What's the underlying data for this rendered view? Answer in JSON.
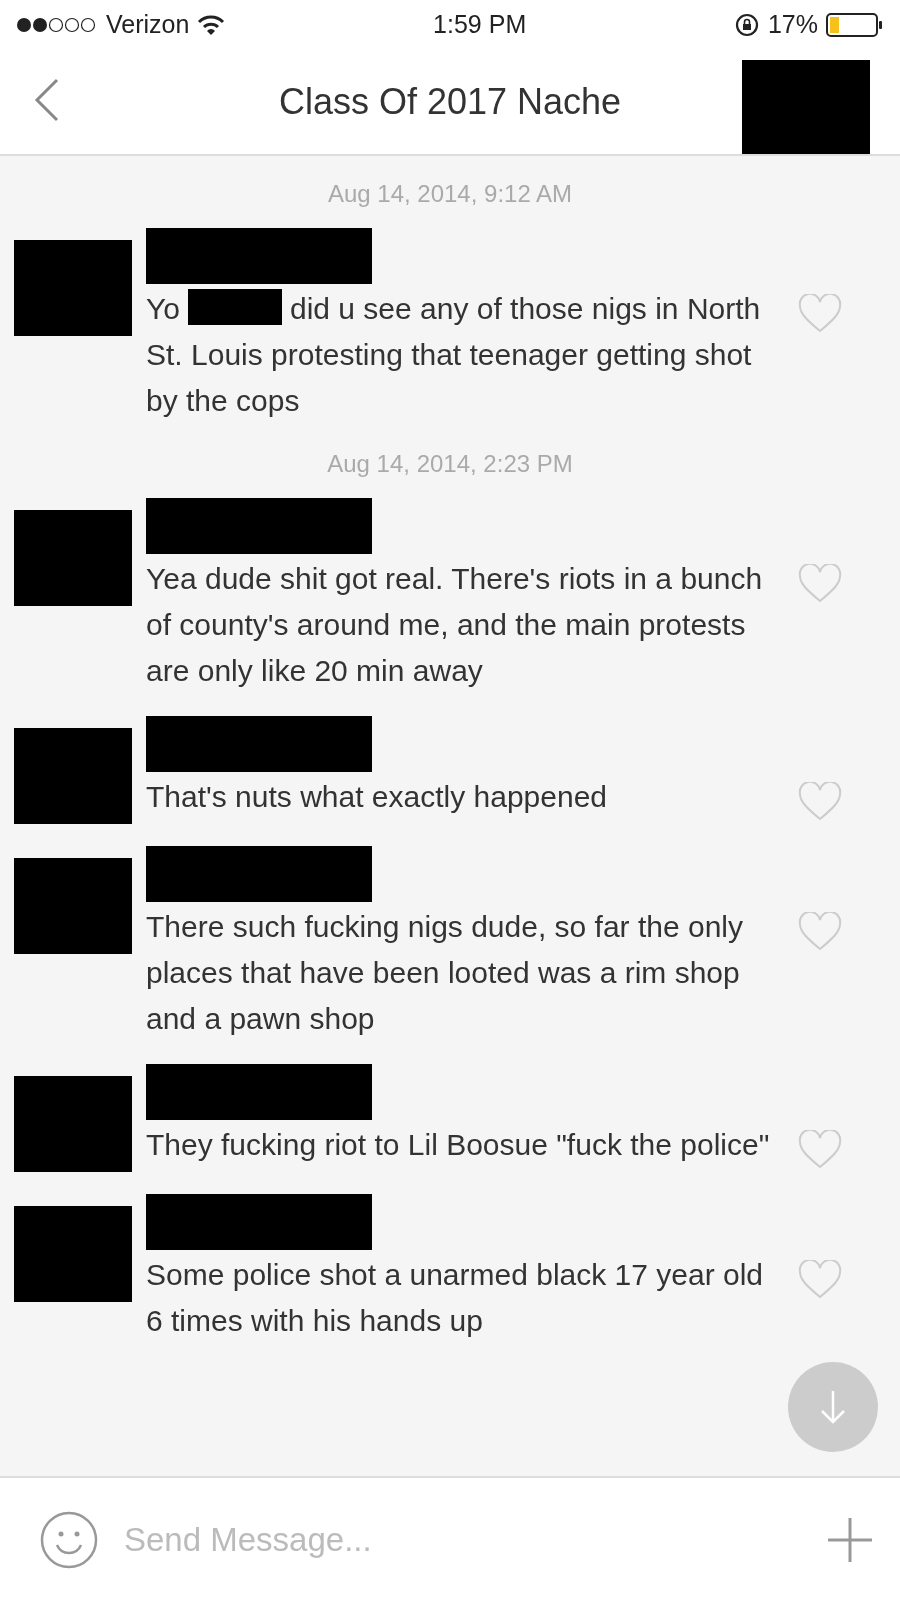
{
  "status_bar": {
    "carrier": "Verizon",
    "time": "1:59 PM",
    "battery": "17%"
  },
  "header": {
    "title": "Class Of 2017 Nache"
  },
  "conversation": [
    {
      "kind": "timestamp",
      "text": "Aug 14, 2014, 9:12 AM"
    },
    {
      "kind": "message",
      "segments": [
        {
          "kind": "text",
          "text": "Yo"
        },
        {
          "kind": "redaction"
        },
        {
          "kind": "text",
          "text": "did u see any of those nigs in North St. Louis protesting that teenager getting shot by the cops"
        }
      ]
    },
    {
      "kind": "timestamp",
      "text": "Aug 14, 2014, 2:23 PM"
    },
    {
      "kind": "message",
      "segments": [
        {
          "kind": "text",
          "text": "Yea dude shit got real. There's riots in a bunch of county's around me, and the main protests are only like 20 min away"
        }
      ]
    },
    {
      "kind": "message",
      "segments": [
        {
          "kind": "text",
          "text": "That's nuts what exactly happened"
        }
      ]
    },
    {
      "kind": "message",
      "segments": [
        {
          "kind": "text",
          "text": "There such fucking nigs dude, so far the only places that have been looted was a rim shop and a pawn shop"
        }
      ]
    },
    {
      "kind": "message",
      "segments": [
        {
          "kind": "text",
          "text": "They fucking riot to Lil Boosue \"fuck the police\""
        }
      ]
    },
    {
      "kind": "message",
      "segments": [
        {
          "kind": "text",
          "text": "Some police shot a unarmed black 17 year old 6 times with his hands up"
        }
      ]
    }
  ],
  "composer": {
    "placeholder": "Send Message..."
  }
}
